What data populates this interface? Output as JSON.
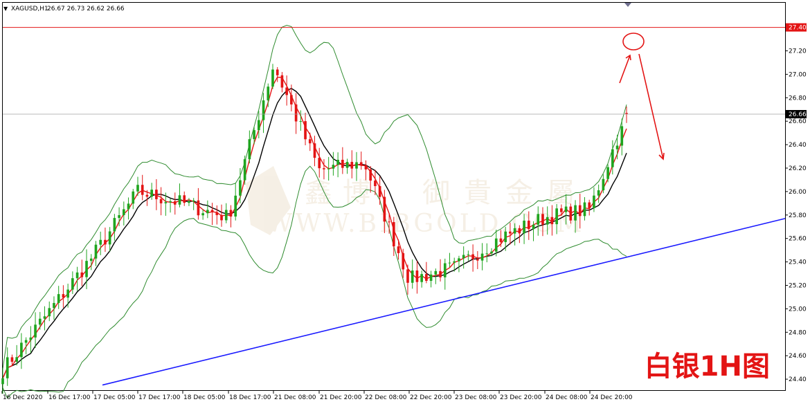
{
  "symbol_header": {
    "symbol": "XAGUSD,H1",
    "ohlc": "26.67 26.73 26.62 26.66"
  },
  "annotation": "白银1H图",
  "watermark": {
    "cn": [
      "鑫",
      "博",
      "",
      "御",
      "貴",
      "金",
      "屬"
    ],
    "en": "WWW.BIBGOLD.COM"
  },
  "colors": {
    "bull_candle": "#1fa51f",
    "bear_candle": "#e31414",
    "bollinger": "#2e8b2e",
    "ma_fast": "#e31414",
    "ma_slow": "#000000",
    "trendline": "#1a1aff",
    "resistance_line": "#e31414",
    "annotation": "#e31414"
  },
  "chart_data": {
    "type": "candlestick",
    "timeframe": "H1",
    "ylim": [
      24.35,
      27.5
    ],
    "y_ticks": [
      "27.20",
      "27.00",
      "26.80",
      "26.60",
      "26.40",
      "26.20",
      "26.00",
      "25.80",
      "25.60",
      "25.40",
      "25.20",
      "25.00",
      "24.80",
      "24.60",
      "24.40"
    ],
    "x_ticks": [
      "16 Dec 2020",
      "16 Dec 17:00",
      "17 Dec 05:00",
      "17 Dec 17:00",
      "18 Dec 05:00",
      "18 Dec 17:00",
      "21 Dec 08:00",
      "21 Dec 20:00",
      "22 Dec 08:00",
      "22 Dec 20:00",
      "23 Dec 08:00",
      "23 Dec 20:00",
      "24 Dec 08:00",
      "24 Dec 20:00"
    ],
    "current_price": "26.66",
    "resistance_level": "27.40",
    "key_points": [
      {
        "time": "16 Dec 2020",
        "price": 24.47
      },
      {
        "time": "17 Dec 05:00",
        "price": 25.45
      },
      {
        "time": "17 Dec 17:00",
        "price": 26.0
      },
      {
        "time": "18 Dec 05:00",
        "price": 25.9
      },
      {
        "time": "18 Dec 17:00",
        "price": 25.78
      },
      {
        "time": "21 Dec 08:00",
        "price": 27.08
      },
      {
        "time": "21 Dec 20:00",
        "price": 26.18
      },
      {
        "time": "22 Dec 08:00",
        "price": 26.25
      },
      {
        "time": "22 Dec 20:00",
        "price": 25.25
      },
      {
        "time": "23 Dec 08:00",
        "price": 25.35
      },
      {
        "time": "23 Dec 20:00",
        "price": 25.6
      },
      {
        "time": "24 Dec 08:00",
        "price": 25.78
      },
      {
        "time": "24 Dec 20:00",
        "price": 25.85
      },
      {
        "time": "24 Dec 23:00",
        "price": 26.66
      }
    ],
    "trendline": {
      "start": {
        "time": "17 Dec 01:00",
        "price": 24.35
      },
      "end": {
        "time": "25 Dec 04:00",
        "price": 25.77
      }
    },
    "grid": false,
    "indicators": [
      "Bollinger Bands",
      "moving average (fast)",
      "moving average (slow)"
    ]
  }
}
